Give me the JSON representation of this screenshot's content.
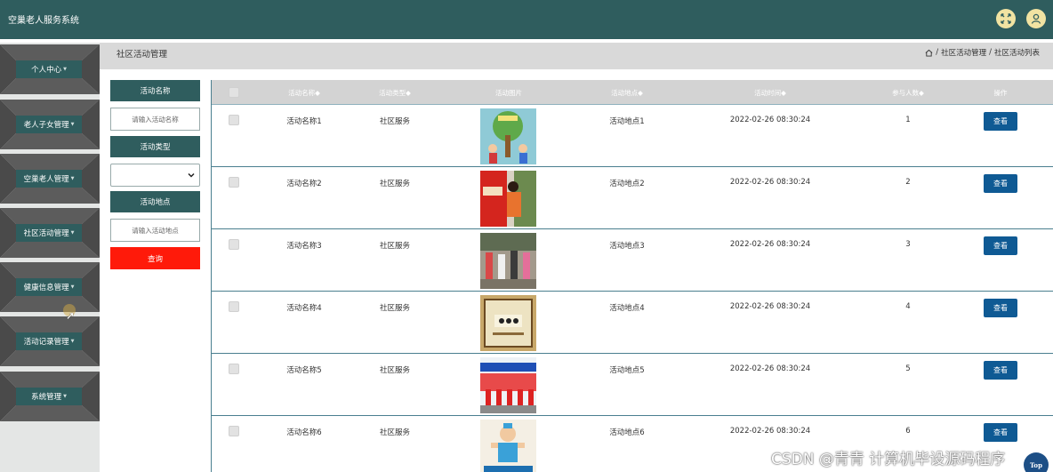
{
  "header": {
    "app_title": "空巢老人服务系统",
    "icons": [
      "fullscreen-icon",
      "user-icon"
    ],
    "bg_color": "#2f5d5e"
  },
  "sidebar": {
    "items": [
      {
        "label": "个人中心"
      },
      {
        "label": "老人子女管理"
      },
      {
        "label": "空巢老人管理"
      },
      {
        "label": "社区活动管理"
      },
      {
        "label": "健康信息管理"
      },
      {
        "label": "活动记录管理"
      },
      {
        "label": "系统管理"
      }
    ]
  },
  "page": {
    "title": "社区活动管理",
    "breadcrumb": [
      "社区活动管理",
      "社区活动列表"
    ],
    "breadcrumb_sep": "/"
  },
  "search": {
    "name_label": "活动名称",
    "name_placeholder": "请输入活动名称",
    "type_label": "活动类型",
    "type_value": "",
    "place_label": "活动地点",
    "place_placeholder": "请输入活动地点",
    "query_label": "查询",
    "query_color": "#ff1a0a"
  },
  "table": {
    "headers": [
      "活动名称",
      "活动类型",
      "活动图片",
      "活动地点",
      "活动时间",
      "参与人数",
      "操作"
    ],
    "sort_marker": "◆",
    "rows": [
      {
        "name": "活动名称1",
        "type": "社区服务",
        "place": "活动地点1",
        "time": "2022-02-26 08:30:24",
        "count": "1",
        "action": "查看"
      },
      {
        "name": "活动名称2",
        "type": "社区服务",
        "place": "活动地点2",
        "time": "2022-02-26 08:30:24",
        "count": "2",
        "action": "查看"
      },
      {
        "name": "活动名称3",
        "type": "社区服务",
        "place": "活动地点3",
        "time": "2022-02-26 08:30:24",
        "count": "3",
        "action": "查看"
      },
      {
        "name": "活动名称4",
        "type": "社区服务",
        "place": "活动地点4",
        "time": "2022-02-26 08:30:24",
        "count": "4",
        "action": "查看"
      },
      {
        "name": "活动名称5",
        "type": "社区服务",
        "place": "活动地点5",
        "time": "2022-02-26 08:30:24",
        "count": "5",
        "action": "查看"
      },
      {
        "name": "活动名称6",
        "type": "社区服务",
        "place": "活动地点6",
        "time": "2022-02-26 08:30:24",
        "count": "6",
        "action": "查看"
      }
    ],
    "view_button_color": "#0f5a94"
  },
  "watermark": "CSDN @青青  计算机毕设源码程序",
  "back_to_top": "Top"
}
